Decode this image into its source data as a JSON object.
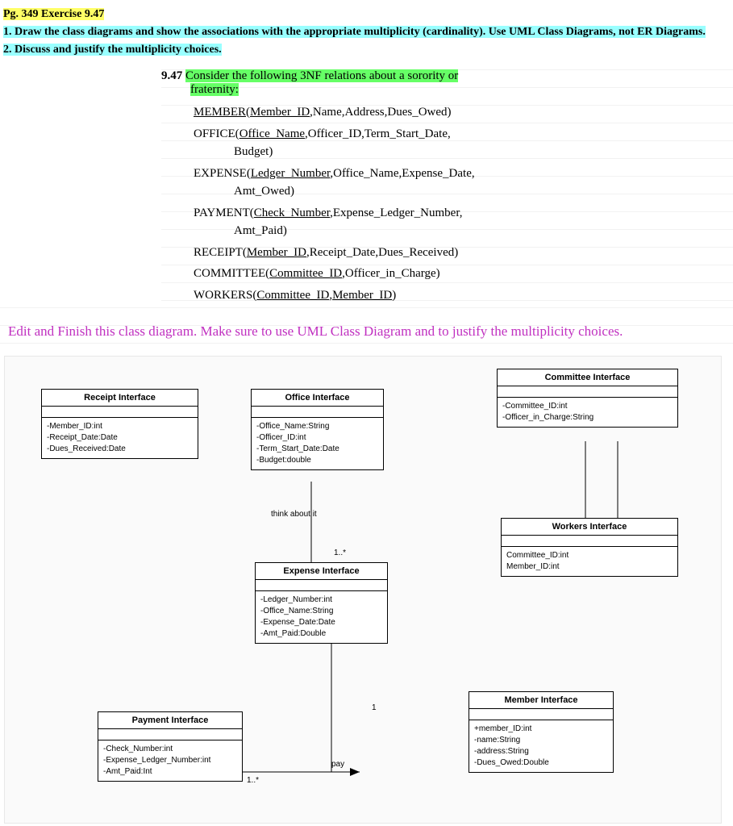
{
  "header": {
    "pg": "Pg. 349 Exercise 9.47",
    "q1": "1. Draw the class diagrams and show the associations with the appropriate multiplicity (cardinality).  Use UML Class Diagrams, not ER Diagrams.",
    "q2": "2. Discuss and justify the multiplicity choices."
  },
  "exercise": {
    "num": "9.47",
    "intro1": "Consider the following 3NF relations about a sorority or",
    "intro2": "fraternity:",
    "rels": [
      "MEMBER(Member_ID,Name,Address,Dues_Owed)",
      "OFFICE(Office_Name,Officer_ID,Term_Start_Date, Budget)",
      "EXPENSE(Ledger_Number,Office_Name,Expense_Date, Amt_Owed)",
      "PAYMENT(Check_Number,Expense_Ledger_Number, Amt_Paid)",
      "RECEIPT(Member_ID,Receipt_Date,Dues_Received)",
      "COMMITTEE(Committee_ID,Officer_in_Charge)",
      "WORKERS(Committee_ID,Member_ID)"
    ]
  },
  "handwrite": "Edit and Finish this class diagram. Make sure to use UML Class Diagram and to justify the multiplicity choices.",
  "boxes": {
    "receipt": {
      "title": "Receipt Interface",
      "attrs": [
        "-Member_ID:int",
        "-Receipt_Date:Date",
        "-Dues_Received:Date"
      ]
    },
    "office": {
      "title": "Office Interface",
      "attrs": [
        "-Office_Name:String",
        "-Officer_ID:int",
        "-Term_Start_Date:Date",
        "-Budget:double"
      ]
    },
    "committee": {
      "title": "Committee Interface",
      "attrs": [
        "-Committee_ID:int",
        "-Officer_in_Charge:String"
      ]
    },
    "workers": {
      "title": "Workers Interface",
      "attrs": [
        "Committee_ID:int",
        "Member_ID:int"
      ]
    },
    "expense": {
      "title": "Expense Interface",
      "attrs": [
        "-Ledger_Number:int",
        "-Office_Name:String",
        "-Expense_Date:Date",
        "-Amt_Paid:Double"
      ]
    },
    "payment": {
      "title": "Payment Interface",
      "attrs": [
        "-Check_Number:int",
        "-Expense_Ledger_Number:int",
        "-Amt_Paid:Int"
      ]
    },
    "member": {
      "title": "Member Interface",
      "attrs": [
        "+member_ID:int",
        "-name:String",
        "-address:String",
        "-Dues_Owed:Double"
      ]
    }
  },
  "labels": {
    "think": "think about it",
    "one_star1": "1..*",
    "one_star2": "1..*",
    "one": "1",
    "pay": "pay"
  }
}
